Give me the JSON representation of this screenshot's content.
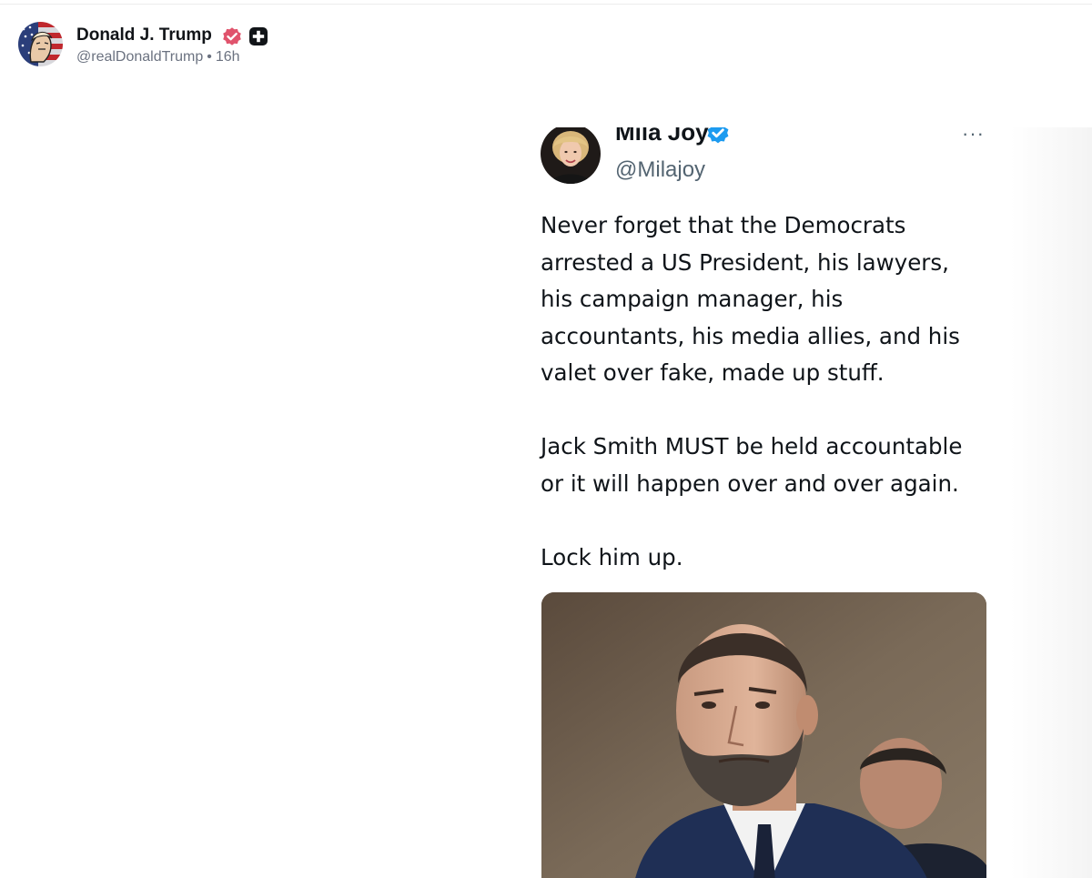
{
  "post": {
    "author_name": "Donald J. Trump",
    "handle": "@realDonaldTrump",
    "separator": "•",
    "time_ago": "16h",
    "avatar_icon": "flag-portrait-avatar",
    "verified_icon": "verified-badge-icon",
    "plus_icon": "plus-badge-icon",
    "colors": {
      "verified": "#e0536c",
      "plus_badge": "#111418",
      "name_text": "#111418",
      "meta_text": "#6b7280"
    }
  },
  "embedded_post": {
    "author_name": "Mila Joy",
    "handle": "@Milajoy",
    "more_label": "···",
    "verified_color": "#1d9bf0",
    "paragraphs": [
      [
        "Never forget that the Democrats",
        "arrested a US President, his lawyers,",
        "his campaign manager, his",
        "accountants, his media allies, and his",
        "valet over fake, made up stuff."
      ],
      [
        "Jack Smith MUST be held accountable",
        "or it will happen over and over again."
      ],
      [
        "Lock him up."
      ]
    ]
  }
}
